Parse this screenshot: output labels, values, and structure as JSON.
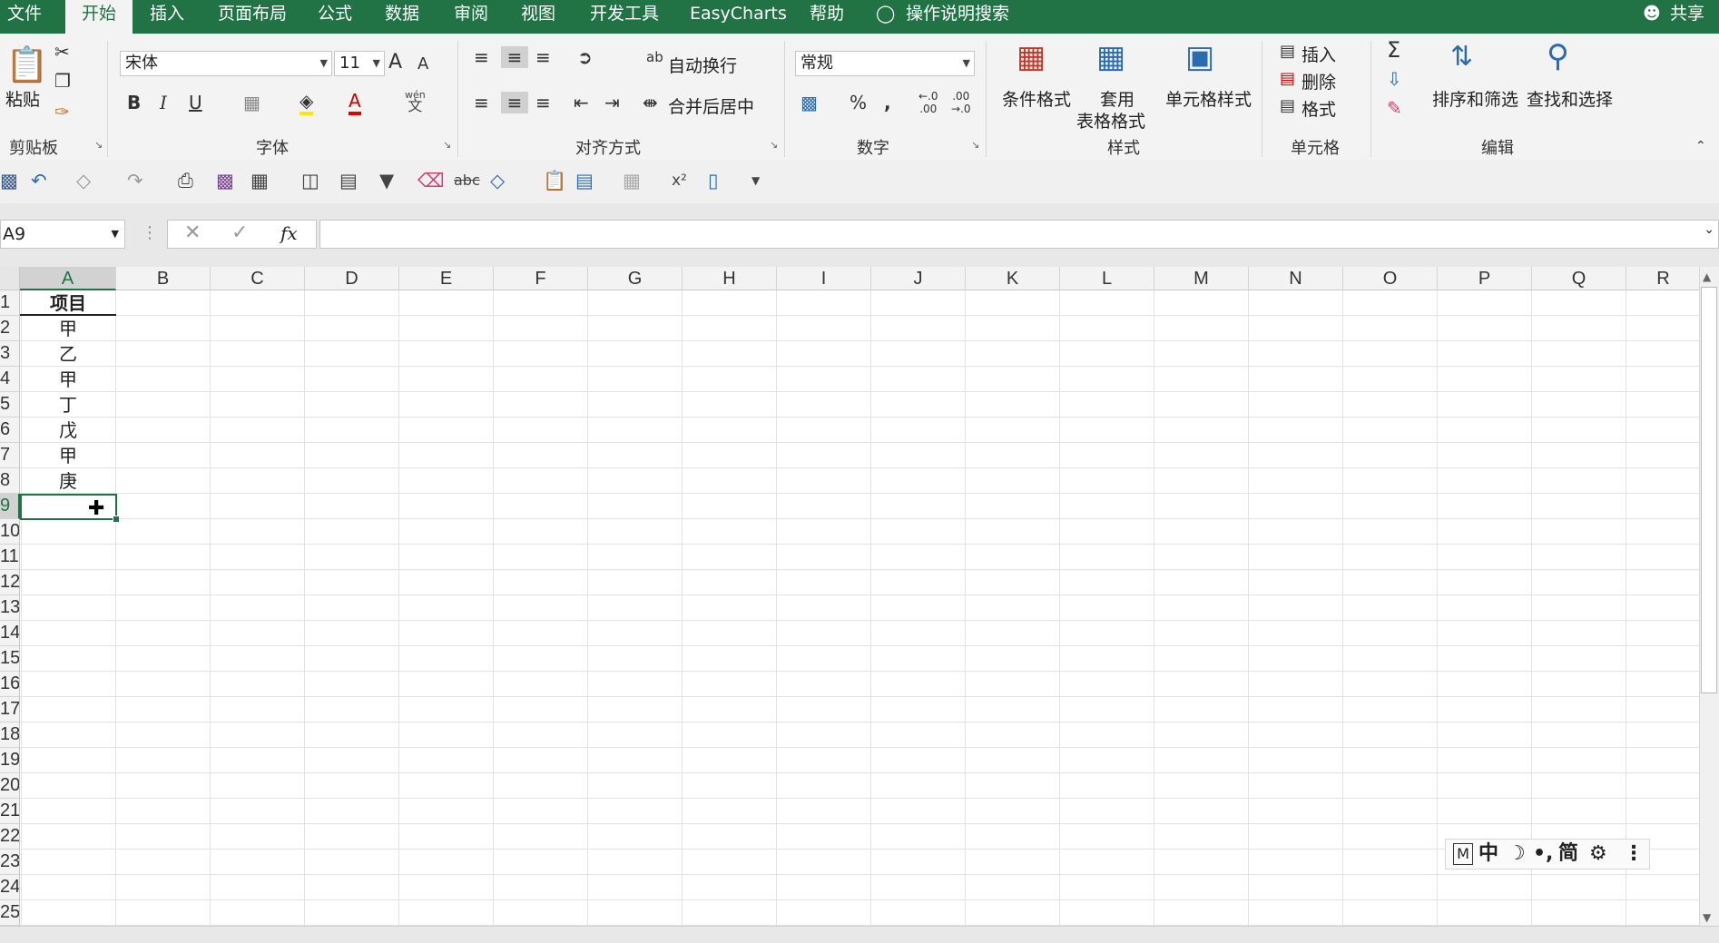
{
  "menu": {
    "items": [
      "文件",
      "开始",
      "插入",
      "页面布局",
      "公式",
      "数据",
      "审阅",
      "视图",
      "开发工具",
      "EasyCharts",
      "帮助"
    ],
    "active": "开始",
    "tell_me": "操作说明搜索",
    "share": "共享"
  },
  "ribbon": {
    "clipboard": {
      "paste": "粘贴",
      "label": "剪贴板"
    },
    "font": {
      "name": "宋体",
      "size": "11",
      "label": "字体",
      "bold": "B",
      "italic": "I",
      "underline": "U",
      "grow": "A",
      "shrink": "A",
      "phonetic_top": "wén",
      "phonetic_bottom": "文"
    },
    "alignment": {
      "wrap_text": "自动换行",
      "merge_center": "合并后居中",
      "label": "对齐方式"
    },
    "number": {
      "format": "常规",
      "percent": "%",
      "comma": "،",
      "label": "数字"
    },
    "styles": {
      "conditional": "条件格式",
      "table_line1": "套用",
      "table_line2": "表格格式",
      "cell_styles": "单元格样式",
      "label": "样式"
    },
    "cells": {
      "insert": "插入",
      "delete": "删除",
      "format": "格式",
      "label": "单元格"
    },
    "editing": {
      "sort_filter": "排序和筛选",
      "find_select": "查找和选择",
      "label": "编辑"
    }
  },
  "formula_bar": {
    "name_box": "A9",
    "formula": "",
    "fx": "fx"
  },
  "sheet": {
    "columns": [
      "A",
      "B",
      "C",
      "D",
      "E",
      "F",
      "G",
      "H",
      "I",
      "J",
      "K",
      "L",
      "M",
      "N",
      "O",
      "P",
      "Q",
      "R"
    ],
    "selected_column": "A",
    "rows": [
      "1",
      "2",
      "3",
      "4",
      "5",
      "6",
      "7",
      "8",
      "9",
      "10",
      "11",
      "12",
      "13",
      "14",
      "15",
      "16",
      "17",
      "18",
      "19",
      "20",
      "21",
      "22",
      "23",
      "24",
      "25"
    ],
    "selected_row": "9",
    "column_a": [
      "项目",
      "甲",
      "乙",
      "甲",
      "丁",
      "戊",
      "甲",
      "庚"
    ],
    "active_cell": "A9"
  },
  "ime_bar": {
    "mode": "中",
    "simplified": "简"
  },
  "colors": {
    "accent": "#217346"
  }
}
